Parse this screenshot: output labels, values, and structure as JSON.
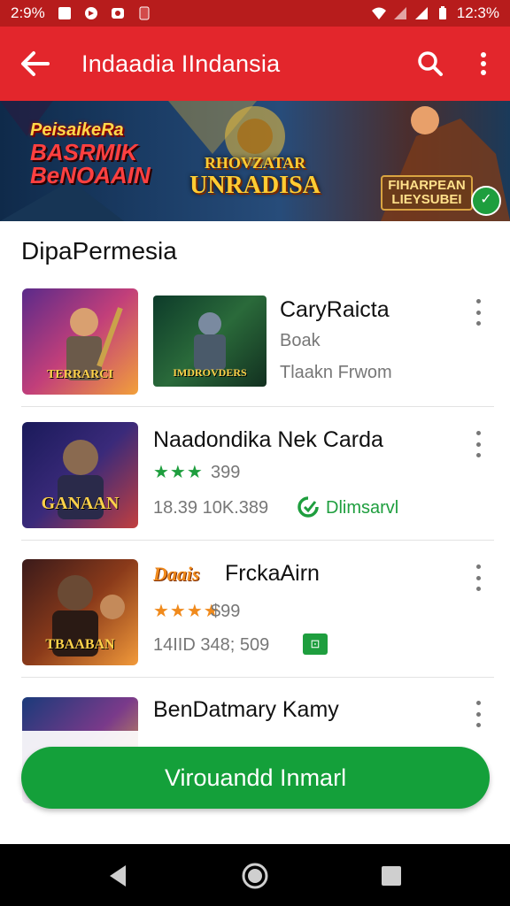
{
  "status_bar": {
    "left_time": "2:9%",
    "right_time": "12:3%"
  },
  "app_bar": {
    "title": "Indaadia IIndansia"
  },
  "banner": {
    "left_line1": "PeisaikeRa",
    "left_line2": "BASRMIK",
    "left_line3": "BeNOAAIN",
    "center_line1": "RHOVZATAR",
    "center_line2": "UNRADISA",
    "right_line1": "FIHARPEAN",
    "right_line2": "LIEYSUBEI"
  },
  "section": {
    "title": "DipaPermesia"
  },
  "apps": [
    {
      "title": "CaryRaicta",
      "sub1": "Boak",
      "sub2": "Tlaakn  Frwom",
      "thumb_caption": "TERRARCI",
      "thumb2_caption": "IMDROVDERS"
    },
    {
      "title": "Naadondika Nek Carda",
      "stars": "★★★",
      "rating": "399",
      "meta": "18.39 10K.389",
      "badge_text": "Dlimsarvl",
      "thumb_caption": "GANAAN"
    },
    {
      "title": "FrckaAirn",
      "logo_text": "Daais",
      "stars": "★★★★",
      "rating": "$99",
      "meta": "14IID 348; 509",
      "thumb_caption": "TBAABAN"
    },
    {
      "title": "BenDatmary Kamy"
    }
  ],
  "install_button": {
    "label": "Virouandd Inmarl"
  },
  "colors": {
    "app_bar": "#e3262c",
    "status_bar": "#b71c1c",
    "install": "#14a03a",
    "star_green": "#1e9e3e",
    "star_orange": "#f08a1c"
  }
}
